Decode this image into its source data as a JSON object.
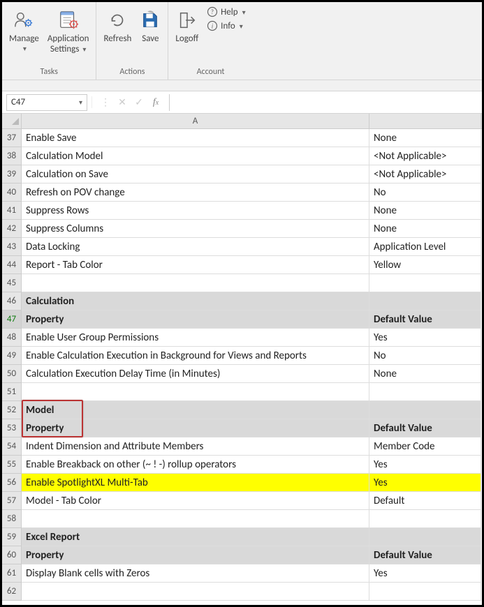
{
  "ribbon": {
    "groups": [
      {
        "label": "Tasks",
        "buttons": [
          {
            "label1": "Manage",
            "label2": "",
            "icon": "manage",
            "caret": true
          },
          {
            "label1": "Application",
            "label2": "Settings",
            "icon": "settings",
            "caret": true
          }
        ]
      },
      {
        "label": "Actions",
        "buttons": [
          {
            "label1": "Refresh",
            "label2": "",
            "icon": "refresh",
            "caret": false
          },
          {
            "label1": "Save",
            "label2": "",
            "icon": "save",
            "caret": false
          }
        ]
      },
      {
        "label": "Account",
        "logoff": "Logoff",
        "mini": [
          {
            "label": "Help",
            "icon": "help"
          },
          {
            "label": "Info",
            "icon": "info"
          }
        ]
      }
    ]
  },
  "name_box": "C47",
  "column_A_label": "A",
  "rows": [
    {
      "n": 37,
      "a": "Enable Save",
      "b": "None"
    },
    {
      "n": 38,
      "a": "Calculation Model",
      "b": "<Not Applicable>"
    },
    {
      "n": 39,
      "a": "Calculation on Save",
      "b": "<Not Applicable>"
    },
    {
      "n": 40,
      "a": "Refresh on POV change",
      "b": "No"
    },
    {
      "n": 41,
      "a": "Suppress Rows",
      "b": "None"
    },
    {
      "n": 42,
      "a": "Suppress Columns",
      "b": "None"
    },
    {
      "n": 43,
      "a": "Data Locking",
      "b": "Application Level"
    },
    {
      "n": 44,
      "a": "Report - Tab Color",
      "b": "Yellow"
    },
    {
      "n": 45,
      "a": "",
      "b": ""
    },
    {
      "n": 46,
      "a": "Calculation",
      "b": "",
      "section": true
    },
    {
      "n": 47,
      "a": "Property",
      "b": "Default Value",
      "section": true,
      "selected": true
    },
    {
      "n": 48,
      "a": "Enable User Group Permissions",
      "b": "Yes"
    },
    {
      "n": 49,
      "a": "Enable Calculation Execution in Background for Views and Reports",
      "b": "No"
    },
    {
      "n": 50,
      "a": "Calculation Execution Delay Time (in Minutes)",
      "b": "None"
    },
    {
      "n": 51,
      "a": "",
      "b": ""
    },
    {
      "n": 52,
      "a": "Model",
      "b": "",
      "section": true
    },
    {
      "n": 53,
      "a": "Property",
      "b": "Default Value",
      "section": true
    },
    {
      "n": 54,
      "a": "Indent Dimension and Attribute Members",
      "b": "Member Code"
    },
    {
      "n": 55,
      "a": "Enable Breakback on other (~ ! -) rollup operators",
      "b": "Yes"
    },
    {
      "n": 56,
      "a": "Enable SpotlightXL Multi-Tab",
      "b": "Yes",
      "yellow": true
    },
    {
      "n": 57,
      "a": "Model - Tab Color",
      "b": "Default"
    },
    {
      "n": 58,
      "a": "",
      "b": ""
    },
    {
      "n": 59,
      "a": "Excel Report",
      "b": "",
      "section": true
    },
    {
      "n": 60,
      "a": "Property",
      "b": "Default Value",
      "section": true
    },
    {
      "n": 61,
      "a": "Display Blank cells with Zeros",
      "b": "Yes"
    },
    {
      "n": 62,
      "a": "",
      "b": ""
    }
  ]
}
